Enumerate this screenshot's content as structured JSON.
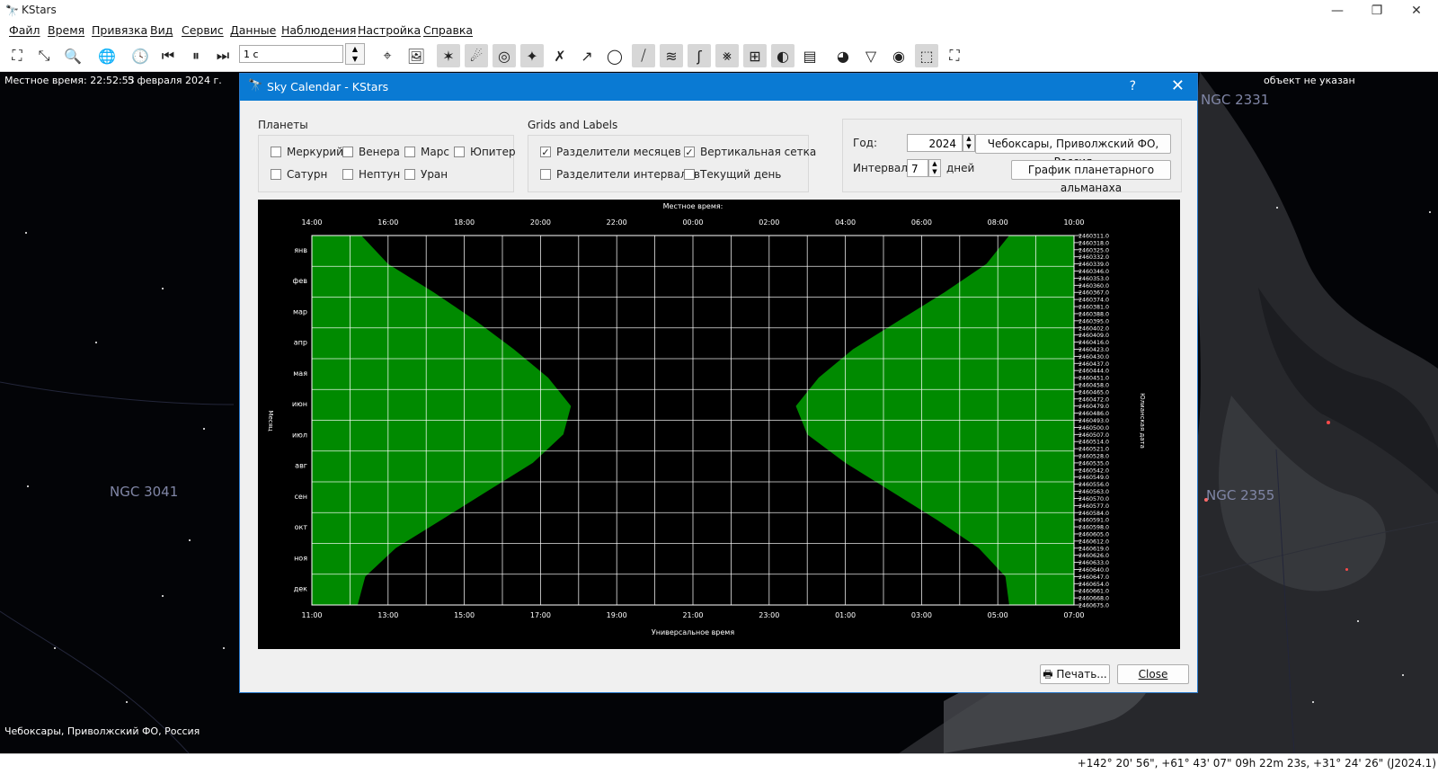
{
  "window": {
    "title": "KStars",
    "minimize": "—",
    "restore": "❐",
    "close": "✕"
  },
  "menu": [
    "Файл",
    "Время",
    "Привязка",
    "Вид",
    "Сервис",
    "Данные",
    "Наблюдения",
    "Настройка",
    "Справка"
  ],
  "toolbar": {
    "time_step": "1 c"
  },
  "sky": {
    "local_time": "Местное время: 22:52:53",
    "date": "5 февраля 2024 г.",
    "object_info": "объект не указан",
    "location": "Чебоксары, Приволжский ФО, Россия",
    "ngc": [
      "NGC 3041",
      "NGC 2331",
      "NGC 2355"
    ]
  },
  "status": {
    "coords": "+142° 20' 56\", +61° 43' 07\"  09h 22m 23s, +31° 24' 26\" (J2024.1)"
  },
  "dialog": {
    "title": "Sky Calendar - KStars",
    "help": "?",
    "close": "✕",
    "planets_title": "Планеты",
    "planets": [
      {
        "label": "Меркурий",
        "checked": false
      },
      {
        "label": "Венера",
        "checked": false
      },
      {
        "label": "Марс",
        "checked": false
      },
      {
        "label": "Юпитер",
        "checked": false
      },
      {
        "label": "Сатурн",
        "checked": false
      },
      {
        "label": "Нептун",
        "checked": false
      },
      {
        "label": "Уран",
        "checked": false
      }
    ],
    "grids_title": "Grids and Labels",
    "grids": [
      {
        "label": "Разделители месяцев",
        "checked": true
      },
      {
        "label": "Вертикальная сетка",
        "checked": true
      },
      {
        "label": "Разделители интервалов",
        "checked": false
      },
      {
        "label": "Текущий день",
        "checked": false
      }
    ],
    "year_label": "Год:",
    "year_value": "2024",
    "location_button": "Чебоксары, Приволжский ФО, Россия",
    "interval_label": "Интервал:",
    "interval_value": "7",
    "days_label": "дней",
    "almanac_button": "График планетарного альманаха",
    "print_button": "Печать...",
    "close_button": "Close"
  },
  "chart_data": {
    "type": "area",
    "top_axis_title": "Местное время:",
    "bottom_axis_title": "Универсальное время",
    "left_axis_title": "Месяц",
    "right_axis_title": "Юлианская дата",
    "top_ticks": [
      "14:00",
      "16:00",
      "18:00",
      "20:00",
      "22:00",
      "00:00",
      "02:00",
      "04:00",
      "06:00",
      "08:00",
      "10:00"
    ],
    "bottom_ticks": [
      "11:00",
      "13:00",
      "15:00",
      "17:00",
      "19:00",
      "21:00",
      "23:00",
      "01:00",
      "03:00",
      "05:00",
      "07:00"
    ],
    "months": [
      "янв",
      "фев",
      "мар",
      "апр",
      "мая",
      "июн",
      "июл",
      "авг",
      "сен",
      "окт",
      "ноя",
      "дек"
    ],
    "julian_dates": [
      "2460311.0",
      "2460318.0",
      "2460325.0",
      "2460332.0",
      "2460339.0",
      "2460346.0",
      "2460353.0",
      "2460360.0",
      "2460367.0",
      "2460374.0",
      "2460381.0",
      "2460388.0",
      "2460395.0",
      "2460402.0",
      "2460409.0",
      "2460416.0",
      "2460423.0",
      "2460430.0",
      "2460437.0",
      "2460444.0",
      "2460451.0",
      "2460458.0",
      "2460465.0",
      "2460472.0",
      "2460479.0",
      "2460486.0",
      "2460493.0",
      "2460500.0",
      "2460507.0",
      "2460514.0",
      "2460521.0",
      "2460528.0",
      "2460535.0",
      "2460542.0",
      "2460549.0",
      "2460556.0",
      "2460563.0",
      "2460570.0",
      "2460577.0",
      "2460584.0",
      "2460591.0",
      "2460598.0",
      "2460605.0",
      "2460612.0",
      "2460619.0",
      "2460626.0",
      "2460633.0",
      "2460640.0",
      "2460647.0",
      "2460654.0",
      "2460661.0",
      "2460668.0",
      "2460675.0"
    ],
    "x_range_ut_hours": [
      11,
      31
    ],
    "sunset_ut": [
      12.3,
      13.0,
      14.2,
      15.3,
      16.3,
      17.2,
      17.8,
      17.6,
      16.8,
      15.6,
      14.4,
      13.2,
      12.4,
      12.2
    ],
    "sunrise_ut": [
      29.3,
      28.7,
      27.6,
      26.4,
      25.2,
      24.3,
      23.7,
      24.0,
      25.0,
      26.2,
      27.4,
      28.5,
      29.2,
      29.3
    ],
    "day_color": "#008a00",
    "night_color": "#000000"
  }
}
